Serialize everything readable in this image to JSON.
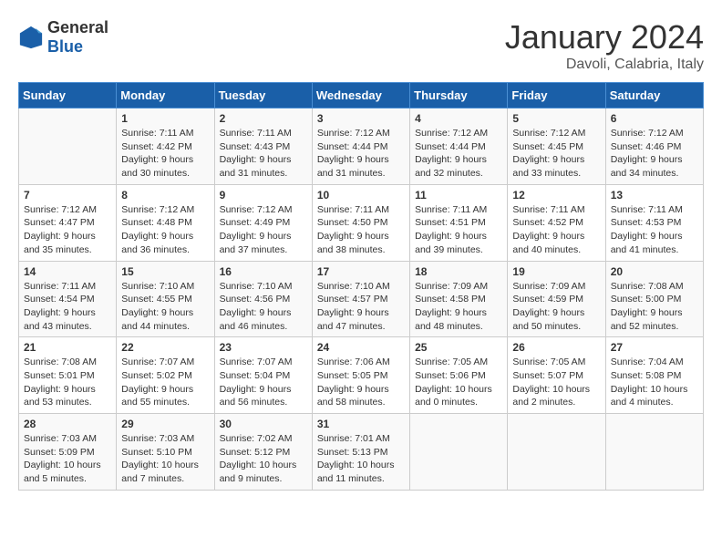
{
  "logo": {
    "general": "General",
    "blue": "Blue"
  },
  "title": "January 2024",
  "subtitle": "Davoli, Calabria, Italy",
  "days_of_week": [
    "Sunday",
    "Monday",
    "Tuesday",
    "Wednesday",
    "Thursday",
    "Friday",
    "Saturday"
  ],
  "weeks": [
    [
      {
        "day": "",
        "content": ""
      },
      {
        "day": "1",
        "content": "Sunrise: 7:11 AM\nSunset: 4:42 PM\nDaylight: 9 hours\nand 30 minutes."
      },
      {
        "day": "2",
        "content": "Sunrise: 7:11 AM\nSunset: 4:43 PM\nDaylight: 9 hours\nand 31 minutes."
      },
      {
        "day": "3",
        "content": "Sunrise: 7:12 AM\nSunset: 4:44 PM\nDaylight: 9 hours\nand 31 minutes."
      },
      {
        "day": "4",
        "content": "Sunrise: 7:12 AM\nSunset: 4:44 PM\nDaylight: 9 hours\nand 32 minutes."
      },
      {
        "day": "5",
        "content": "Sunrise: 7:12 AM\nSunset: 4:45 PM\nDaylight: 9 hours\nand 33 minutes."
      },
      {
        "day": "6",
        "content": "Sunrise: 7:12 AM\nSunset: 4:46 PM\nDaylight: 9 hours\nand 34 minutes."
      }
    ],
    [
      {
        "day": "7",
        "content": "Sunrise: 7:12 AM\nSunset: 4:47 PM\nDaylight: 9 hours\nand 35 minutes."
      },
      {
        "day": "8",
        "content": "Sunrise: 7:12 AM\nSunset: 4:48 PM\nDaylight: 9 hours\nand 36 minutes."
      },
      {
        "day": "9",
        "content": "Sunrise: 7:12 AM\nSunset: 4:49 PM\nDaylight: 9 hours\nand 37 minutes."
      },
      {
        "day": "10",
        "content": "Sunrise: 7:11 AM\nSunset: 4:50 PM\nDaylight: 9 hours\nand 38 minutes."
      },
      {
        "day": "11",
        "content": "Sunrise: 7:11 AM\nSunset: 4:51 PM\nDaylight: 9 hours\nand 39 minutes."
      },
      {
        "day": "12",
        "content": "Sunrise: 7:11 AM\nSunset: 4:52 PM\nDaylight: 9 hours\nand 40 minutes."
      },
      {
        "day": "13",
        "content": "Sunrise: 7:11 AM\nSunset: 4:53 PM\nDaylight: 9 hours\nand 41 minutes."
      }
    ],
    [
      {
        "day": "14",
        "content": "Sunrise: 7:11 AM\nSunset: 4:54 PM\nDaylight: 9 hours\nand 43 minutes."
      },
      {
        "day": "15",
        "content": "Sunrise: 7:10 AM\nSunset: 4:55 PM\nDaylight: 9 hours\nand 44 minutes."
      },
      {
        "day": "16",
        "content": "Sunrise: 7:10 AM\nSunset: 4:56 PM\nDaylight: 9 hours\nand 46 minutes."
      },
      {
        "day": "17",
        "content": "Sunrise: 7:10 AM\nSunset: 4:57 PM\nDaylight: 9 hours\nand 47 minutes."
      },
      {
        "day": "18",
        "content": "Sunrise: 7:09 AM\nSunset: 4:58 PM\nDaylight: 9 hours\nand 48 minutes."
      },
      {
        "day": "19",
        "content": "Sunrise: 7:09 AM\nSunset: 4:59 PM\nDaylight: 9 hours\nand 50 minutes."
      },
      {
        "day": "20",
        "content": "Sunrise: 7:08 AM\nSunset: 5:00 PM\nDaylight: 9 hours\nand 52 minutes."
      }
    ],
    [
      {
        "day": "21",
        "content": "Sunrise: 7:08 AM\nSunset: 5:01 PM\nDaylight: 9 hours\nand 53 minutes."
      },
      {
        "day": "22",
        "content": "Sunrise: 7:07 AM\nSunset: 5:02 PM\nDaylight: 9 hours\nand 55 minutes."
      },
      {
        "day": "23",
        "content": "Sunrise: 7:07 AM\nSunset: 5:04 PM\nDaylight: 9 hours\nand 56 minutes."
      },
      {
        "day": "24",
        "content": "Sunrise: 7:06 AM\nSunset: 5:05 PM\nDaylight: 9 hours\nand 58 minutes."
      },
      {
        "day": "25",
        "content": "Sunrise: 7:05 AM\nSunset: 5:06 PM\nDaylight: 10 hours\nand 0 minutes."
      },
      {
        "day": "26",
        "content": "Sunrise: 7:05 AM\nSunset: 5:07 PM\nDaylight: 10 hours\nand 2 minutes."
      },
      {
        "day": "27",
        "content": "Sunrise: 7:04 AM\nSunset: 5:08 PM\nDaylight: 10 hours\nand 4 minutes."
      }
    ],
    [
      {
        "day": "28",
        "content": "Sunrise: 7:03 AM\nSunset: 5:09 PM\nDaylight: 10 hours\nand 5 minutes."
      },
      {
        "day": "29",
        "content": "Sunrise: 7:03 AM\nSunset: 5:10 PM\nDaylight: 10 hours\nand 7 minutes."
      },
      {
        "day": "30",
        "content": "Sunrise: 7:02 AM\nSunset: 5:12 PM\nDaylight: 10 hours\nand 9 minutes."
      },
      {
        "day": "31",
        "content": "Sunrise: 7:01 AM\nSunset: 5:13 PM\nDaylight: 10 hours\nand 11 minutes."
      },
      {
        "day": "",
        "content": ""
      },
      {
        "day": "",
        "content": ""
      },
      {
        "day": "",
        "content": ""
      }
    ]
  ]
}
